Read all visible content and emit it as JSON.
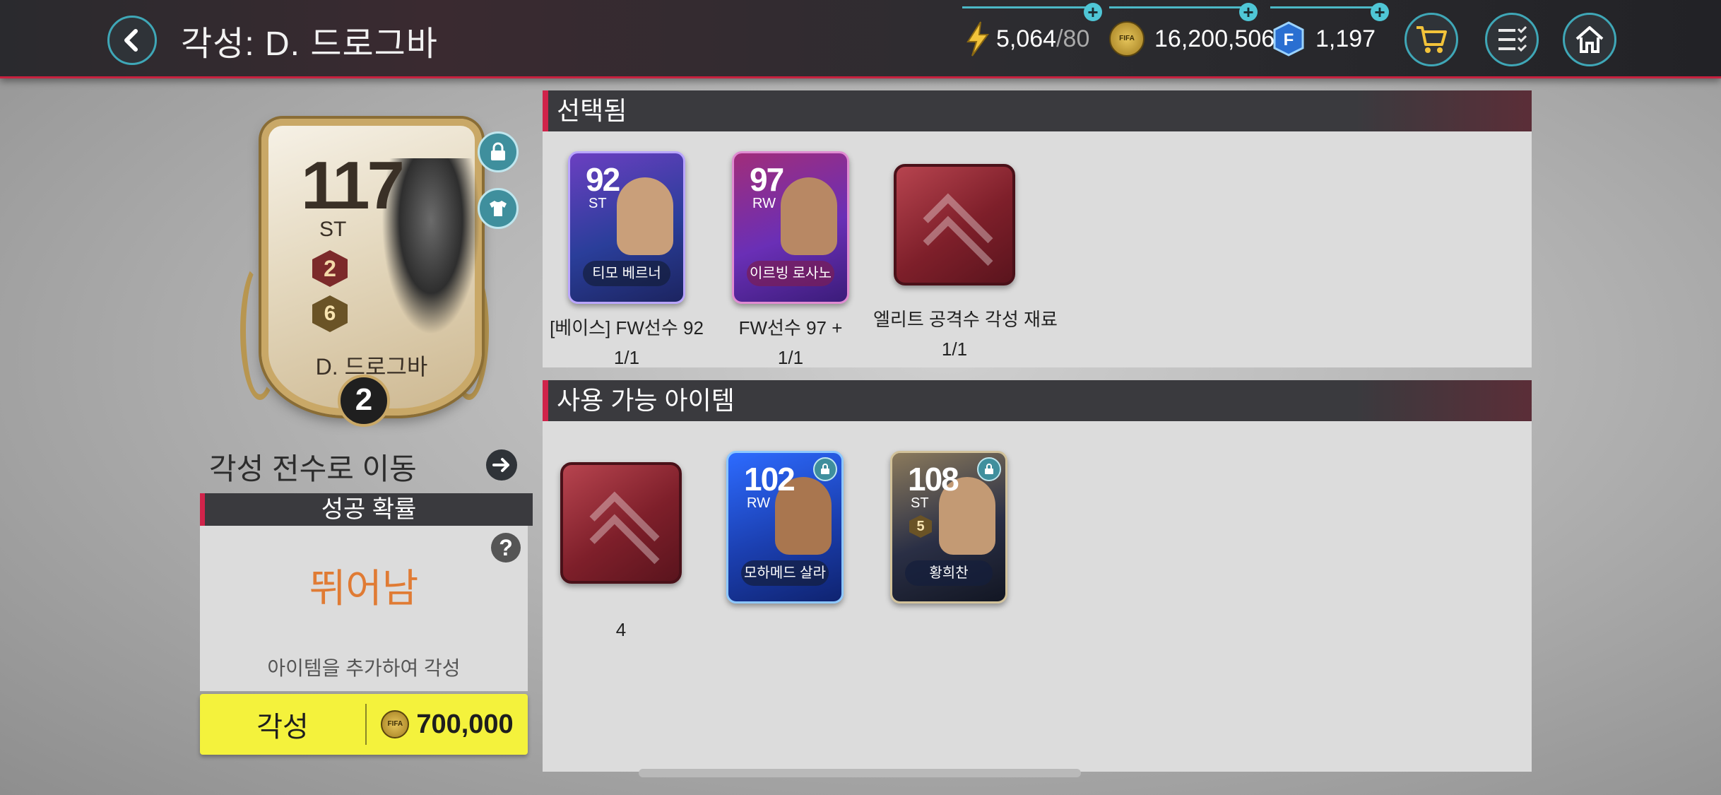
{
  "header": {
    "title": "각성: D. 드로그바",
    "energy": {
      "current": "5,064",
      "max": "/80"
    },
    "coins": "16,200,506",
    "fifa_points": "1,197"
  },
  "player_card": {
    "ovr": "117",
    "position": "ST",
    "rank_badge": "2",
    "training_badge": "6",
    "name": "D. 드로그바",
    "awaken_level": "2"
  },
  "move_to_player": "각성 전수로 이동",
  "success": {
    "heading": "성공 확률",
    "value": "뛰어남",
    "hint": "아이템을 추가하여 각성"
  },
  "awaken_button": {
    "label": "각성",
    "cost": "700,000"
  },
  "selected_panel": {
    "title": "선택됨",
    "items": [
      {
        "ovr": "92",
        "position": "ST",
        "card_name": "티모 베르너",
        "label": "[베이스] FW선수 92",
        "count": "1/1"
      },
      {
        "ovr": "97",
        "position": "RW",
        "card_name": "이르빙 로사노",
        "label": "FW선수 97 +",
        "count": "1/1"
      },
      {
        "label": "엘리트 공격수 각성 재료",
        "count": "1/1"
      }
    ]
  },
  "available_panel": {
    "title": "사용 가능 아이템",
    "items": [
      {
        "count": "4"
      },
      {
        "ovr": "102",
        "position": "RW",
        "card_name": "모하메드 살라"
      },
      {
        "ovr": "108",
        "position": "ST",
        "card_name": "황희찬",
        "badge": "5"
      }
    ]
  },
  "colors": {
    "accent": "#d0234a",
    "teal": "#3fa7b7",
    "awaken_button": "#f4f23c",
    "success_text": "#e07b34"
  },
  "icons": [
    "back-arrow-icon",
    "lightning-icon",
    "coin-icon",
    "fifa-points-icon",
    "cart-icon",
    "checklist-icon",
    "home-icon",
    "lock-icon",
    "jersey-icon",
    "arrow-right-icon",
    "help-icon"
  ]
}
